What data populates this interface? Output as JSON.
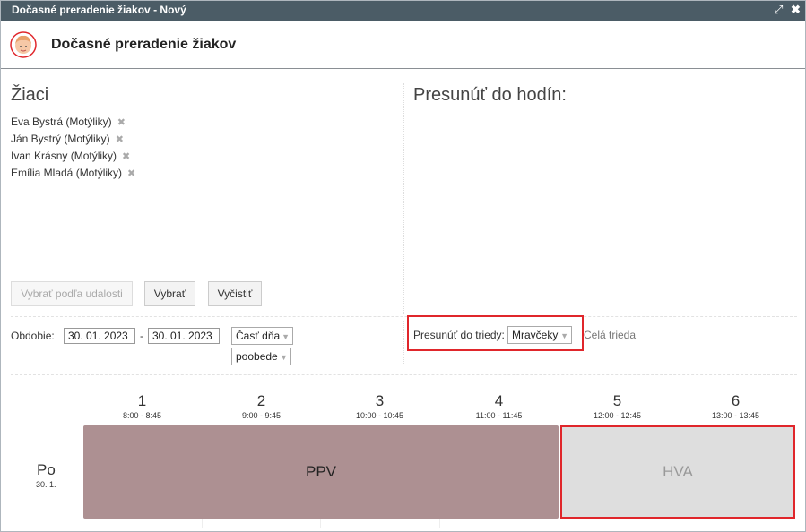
{
  "window": {
    "title": "Dočasné preradenie žiakov - Nový",
    "colors": {
      "titlebar": "#4b5c66",
      "highlight": "#e0262b",
      "ppv_block": "#ad9092",
      "hva_block": "#dedede"
    }
  },
  "header": {
    "title": "Dočasné preradenie žiakov",
    "icon": "student-face-icon"
  },
  "students_panel": {
    "title": "Žiaci",
    "items": [
      {
        "name": "Eva Bystrá (Motýliky)"
      },
      {
        "name": "Ján Bystrý (Motýliky)"
      },
      {
        "name": "Ivan Krásny (Motýliky)"
      },
      {
        "name": "Emília Mladá (Motýliky)"
      }
    ],
    "remove_symbol": "✖",
    "buttons": {
      "select_by_event": "Vybrať podľa udalosti",
      "select": "Vybrať",
      "clear": "Vyčistiť"
    }
  },
  "move_panel": {
    "title": "Presunúť do hodín:"
  },
  "period": {
    "label": "Obdobie:",
    "from": "30. 01. 2023",
    "separator": "-",
    "to": "30. 01. 2023",
    "part_of_day": "Časť dňa",
    "part_value": "poobede"
  },
  "move_to_class": {
    "label": "Presunúť do triedy:",
    "value": "Mravčeky",
    "whole_class": "Celá trieda"
  },
  "timetable": {
    "lessons": [
      {
        "num": "1",
        "time": "8:00 - 8:45"
      },
      {
        "num": "2",
        "time": "9:00 - 9:45"
      },
      {
        "num": "3",
        "time": "10:00 - 10:45"
      },
      {
        "num": "4",
        "time": "11:00 - 11:45"
      },
      {
        "num": "5",
        "time": "12:00 - 12:45"
      },
      {
        "num": "6",
        "time": "13:00 - 13:45"
      }
    ],
    "day": "Po",
    "date": "30. 1.",
    "blocks": [
      {
        "label": "PPV"
      },
      {
        "label": "HVA"
      }
    ]
  }
}
